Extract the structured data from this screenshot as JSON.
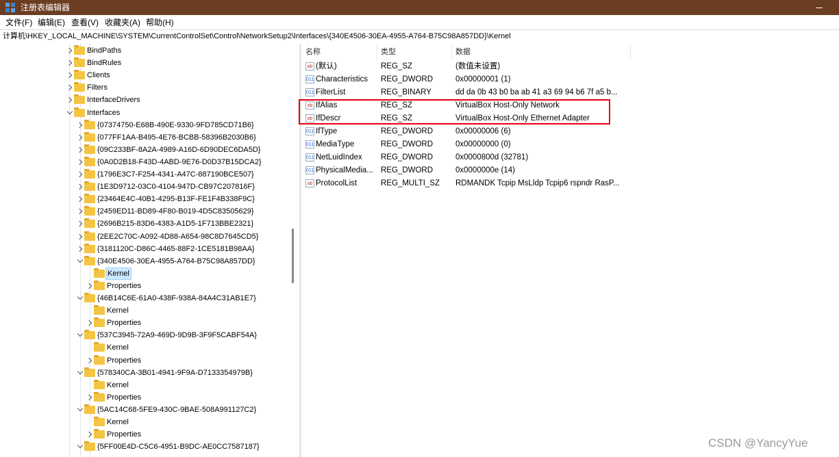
{
  "window": {
    "title": "注册表编辑器",
    "accent_color": "#6b3d22"
  },
  "menu": [
    "文件(F)",
    "编辑(E)",
    "查看(V)",
    "收藏夹(A)",
    "帮助(H)"
  ],
  "address": "计算机\\HKEY_LOCAL_MACHINE\\SYSTEM\\CurrentControlSet\\Control\\NetworkSetup2\\Interfaces\\{340E4506-30EA-4955-A764-B75C98A857DD}\\Kernel",
  "tree": [
    {
      "label": "BindPaths",
      "level": 0,
      "expander": "right"
    },
    {
      "label": "BindRules",
      "level": 0,
      "expander": "right"
    },
    {
      "label": "Clients",
      "level": 0,
      "expander": "right"
    },
    {
      "label": "Filters",
      "level": 0,
      "expander": "right"
    },
    {
      "label": "InterfaceDrivers",
      "level": 0,
      "expander": "right"
    },
    {
      "label": "Interfaces",
      "level": 0,
      "expander": "down"
    },
    {
      "label": "{07374750-E68B-490E-9330-9FD785CD71B6}",
      "level": 1,
      "expander": "right"
    },
    {
      "label": "{077FF1AA-B495-4E76-BCBB-58396B2030B6}",
      "level": 1,
      "expander": "right"
    },
    {
      "label": "{09C233BF-8A2A-4989-A16D-6D90DEC6DA5D}",
      "level": 1,
      "expander": "right"
    },
    {
      "label": "{0A0D2B18-F43D-4ABD-9E76-D0D37B15DCA2}",
      "level": 1,
      "expander": "right"
    },
    {
      "label": "{1796E3C7-F254-4341-A47C-887190BCE507}",
      "level": 1,
      "expander": "right"
    },
    {
      "label": "{1E3D9712-03C0-4104-947D-CB97C207816F}",
      "level": 1,
      "expander": "right"
    },
    {
      "label": "{23464E4C-40B1-4295-B13F-FE1F4B338F9C}",
      "level": 1,
      "expander": "right"
    },
    {
      "label": "{2459ED11-BD89-4F80-B019-4D5C83505629}",
      "level": 1,
      "expander": "right"
    },
    {
      "label": "{2696B215-83D6-4383-A1D5-1F713BBE2321}",
      "level": 1,
      "expander": "right"
    },
    {
      "label": "{2EE2C70C-A092-4D88-A654-98C8D7645CD5}",
      "level": 1,
      "expander": "right"
    },
    {
      "label": "{3181120C-D86C-4465-88F2-1CE5181B98AA}",
      "level": 1,
      "expander": "right"
    },
    {
      "label": "{340E4506-30EA-4955-A764-B75C98A857DD}",
      "level": 1,
      "expander": "down"
    },
    {
      "label": "Kernel",
      "level": 2,
      "expander": "none",
      "selected": true
    },
    {
      "label": "Properties",
      "level": 2,
      "expander": "right"
    },
    {
      "label": "{46B14C6E-61A0-438F-938A-84A4C31AB1E7}",
      "level": 1,
      "expander": "down"
    },
    {
      "label": "Kernel",
      "level": 2,
      "expander": "none"
    },
    {
      "label": "Properties",
      "level": 2,
      "expander": "right"
    },
    {
      "label": "{537C3945-72A9-469D-9D9B-3F9F5CABF54A}",
      "level": 1,
      "expander": "down"
    },
    {
      "label": "Kernel",
      "level": 2,
      "expander": "none"
    },
    {
      "label": "Properties",
      "level": 2,
      "expander": "right"
    },
    {
      "label": "{578340CA-3B01-4941-9F9A-D7133354979B}",
      "level": 1,
      "expander": "down"
    },
    {
      "label": "Kernel",
      "level": 2,
      "expander": "none"
    },
    {
      "label": "Properties",
      "level": 2,
      "expander": "right"
    },
    {
      "label": "{5AC14C68-5FE9-430C-9BAE-508A991127C2}",
      "level": 1,
      "expander": "down"
    },
    {
      "label": "Kernel",
      "level": 2,
      "expander": "none"
    },
    {
      "label": "Properties",
      "level": 2,
      "expander": "right"
    },
    {
      "label": "{5FF00E4D-C5C6-4951-B9DC-AE0CC7587187}",
      "level": 1,
      "expander": "down"
    }
  ],
  "values": {
    "headers": {
      "name": "名称",
      "type": "类型",
      "data": "数据"
    },
    "rows": [
      {
        "icon": "string-value-icon",
        "badge": "ab",
        "name": "(默认)",
        "type": "REG_SZ",
        "data": "(数值未设置)"
      },
      {
        "icon": "binary-value-icon",
        "badge": "011",
        "name": "Characteristics",
        "type": "REG_DWORD",
        "data": "0x00000001 (1)"
      },
      {
        "icon": "binary-value-icon",
        "badge": "011",
        "name": "FilterList",
        "type": "REG_BINARY",
        "data": "dd da 0b 43 b0 ba ab 41 a3 69 94 b6 7f a5 b..."
      },
      {
        "icon": "string-value-icon",
        "badge": "ab",
        "name": "IfAlias",
        "type": "REG_SZ",
        "data": "VirtualBox Host-Only Network"
      },
      {
        "icon": "string-value-icon",
        "badge": "ab",
        "name": "IfDescr",
        "type": "REG_SZ",
        "data": "VirtualBox Host-Only Ethernet Adapter"
      },
      {
        "icon": "binary-value-icon",
        "badge": "011",
        "name": "IfType",
        "type": "REG_DWORD",
        "data": "0x00000006 (6)"
      },
      {
        "icon": "binary-value-icon",
        "badge": "011",
        "name": "MediaType",
        "type": "REG_DWORD",
        "data": "0x00000000 (0)"
      },
      {
        "icon": "binary-value-icon",
        "badge": "011",
        "name": "NetLuidIndex",
        "type": "REG_DWORD",
        "data": "0x0000800d (32781)"
      },
      {
        "icon": "binary-value-icon",
        "badge": "011",
        "name": "PhysicalMedia...",
        "type": "REG_DWORD",
        "data": "0x0000000e (14)"
      },
      {
        "icon": "string-value-icon",
        "badge": "ab",
        "name": "ProtocolList",
        "type": "REG_MULTI_SZ",
        "data": "RDMANDK Tcpip MsLldp Tcpip6 rspndr RasP..."
      }
    ]
  },
  "highlight_color": "#e60012",
  "watermark": "CSDN @YancyYue"
}
